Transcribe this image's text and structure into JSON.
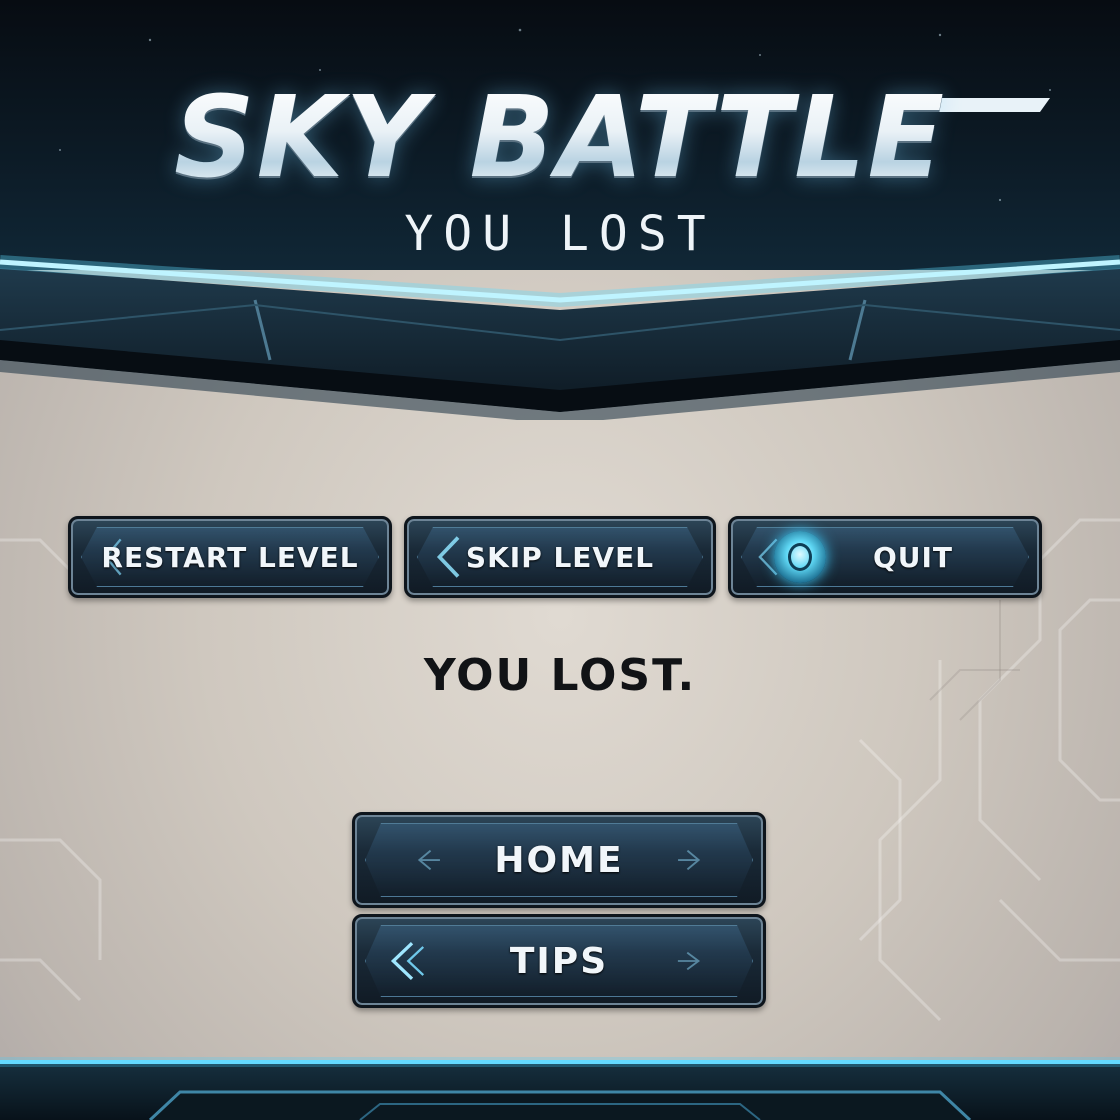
{
  "header": {
    "title": "SKY BATTLE",
    "subtitle": "YOU LOST"
  },
  "actions": {
    "restart_label": "RESTART LEVEL",
    "skip_label": "SKIP LEVEL",
    "quit_label": "QUIT",
    "quit_icon": "power-orb-icon"
  },
  "status": {
    "message": "YOU LOST."
  },
  "menu": {
    "home_label": "HOME",
    "tips_label": "TIPS"
  },
  "colors": {
    "accent_glow": "#3fd0ff",
    "header_bg": "#0a121a",
    "panel_bg": "#cfc8bf",
    "button_bg": "#1a2a38"
  }
}
